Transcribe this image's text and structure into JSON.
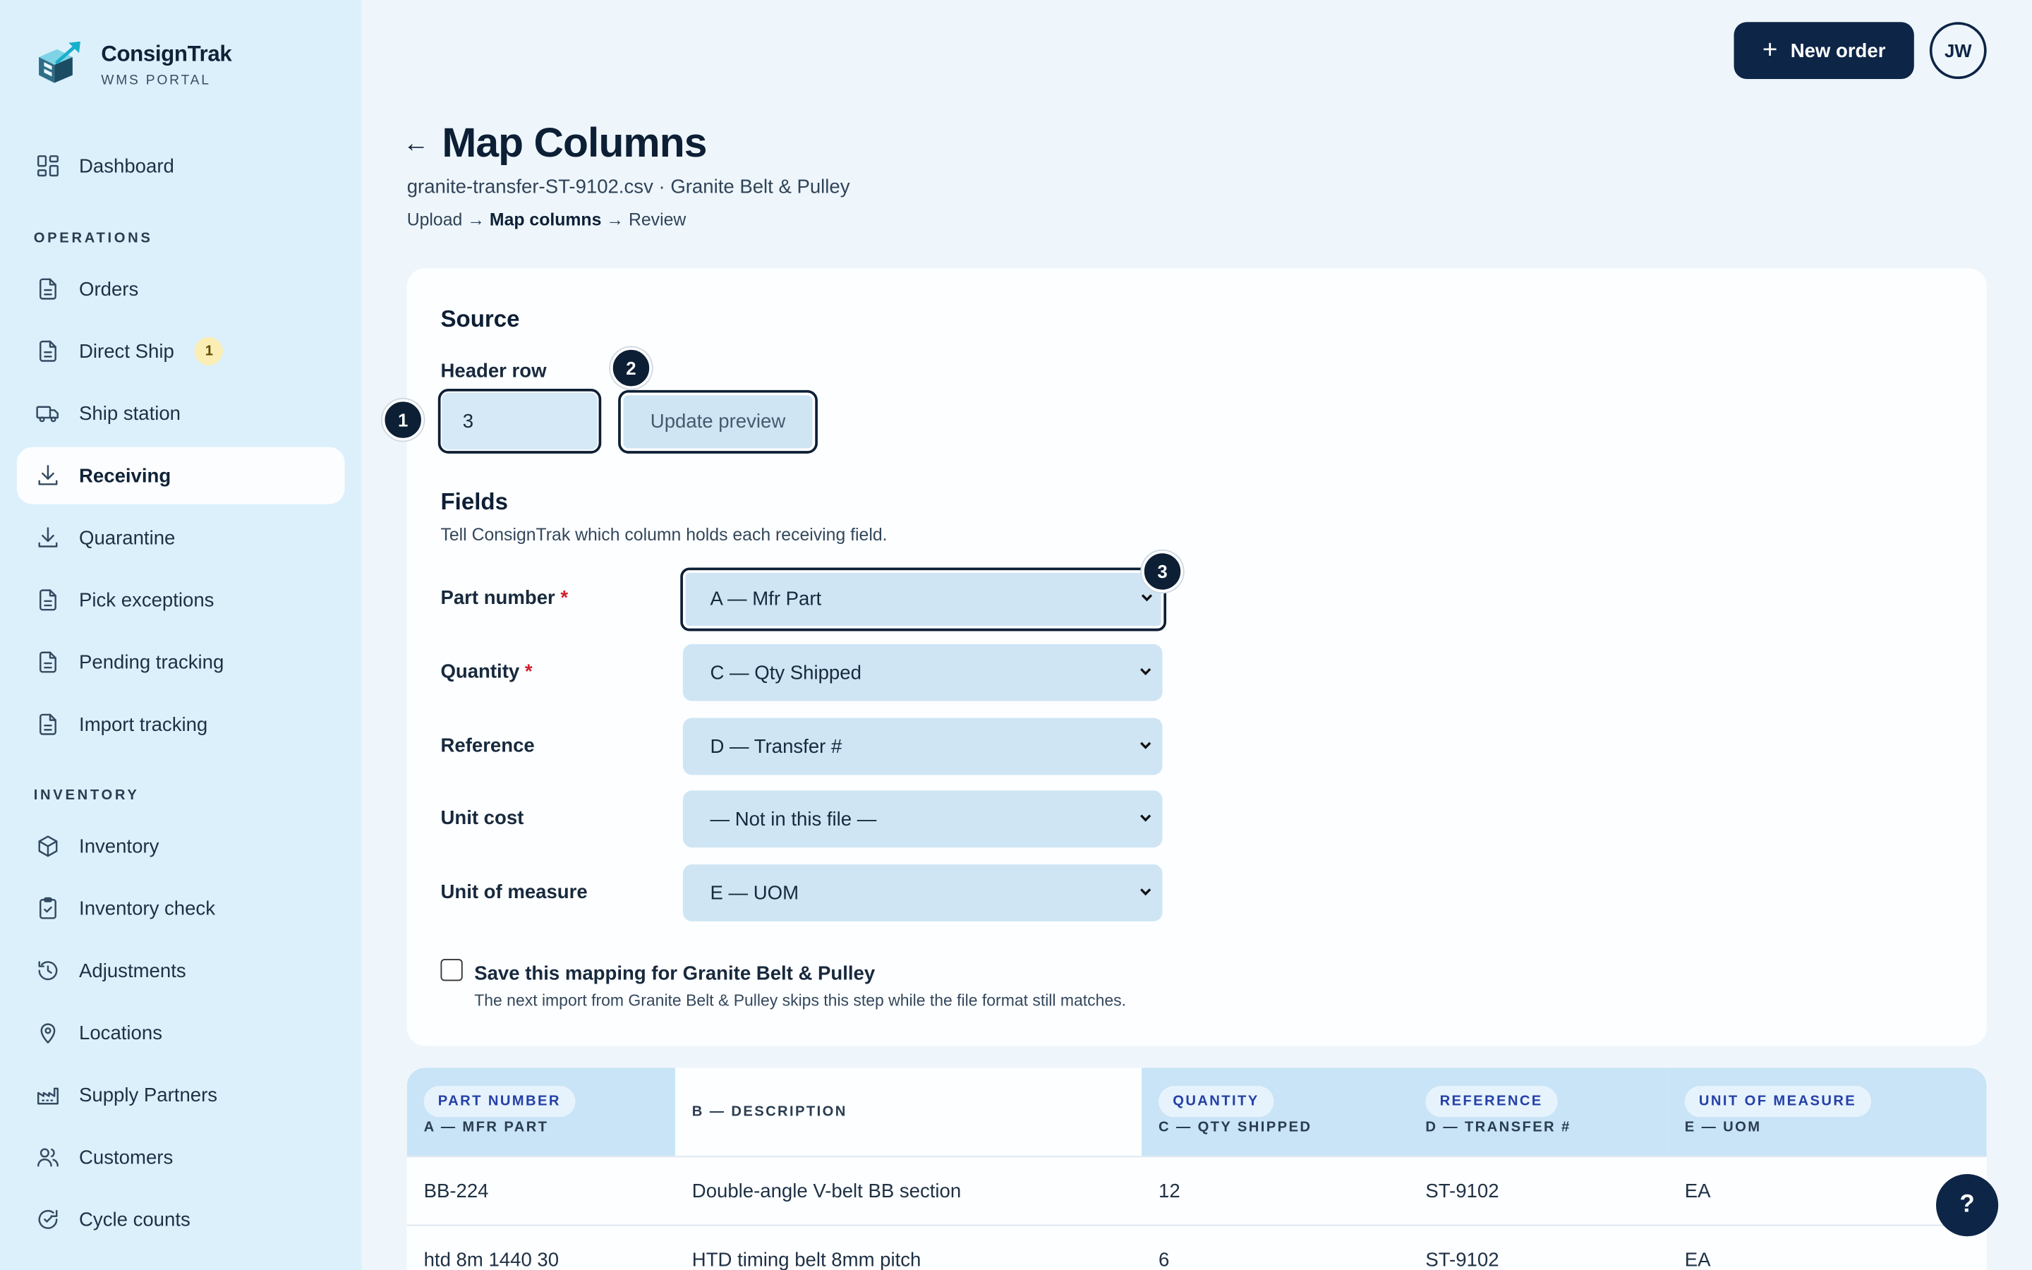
{
  "brand": {
    "name": "ConsignTrak",
    "subtitle": "WMS PORTAL"
  },
  "sidebar": {
    "top": [
      {
        "label": "Dashboard",
        "icon": "dashboard-icon"
      }
    ],
    "operations_label": "OPERATIONS",
    "operations": [
      {
        "label": "Orders",
        "icon": "document-icon"
      },
      {
        "label": "Direct Ship",
        "icon": "document-icon",
        "badge": "1"
      },
      {
        "label": "Ship station",
        "icon": "truck-icon"
      },
      {
        "label": "Receiving",
        "icon": "download-icon",
        "active": true
      },
      {
        "label": "Quarantine",
        "icon": "download-icon"
      },
      {
        "label": "Pick exceptions",
        "icon": "document-icon"
      },
      {
        "label": "Pending tracking",
        "icon": "document-icon"
      },
      {
        "label": "Import tracking",
        "icon": "document-icon"
      }
    ],
    "inventory_label": "INVENTORY",
    "inventory": [
      {
        "label": "Inventory",
        "icon": "box-icon"
      },
      {
        "label": "Inventory check",
        "icon": "clipboard-check-icon"
      },
      {
        "label": "Adjustments",
        "icon": "history-icon"
      },
      {
        "label": "Locations",
        "icon": "map-pin-icon"
      },
      {
        "label": "Supply Partners",
        "icon": "factory-icon"
      },
      {
        "label": "Customers",
        "icon": "users-icon"
      },
      {
        "label": "Cycle counts",
        "icon": "refresh-check-icon"
      }
    ]
  },
  "topbar": {
    "new_order_label": "New order",
    "new_order_plus": "+",
    "avatar_initials": "JW"
  },
  "header": {
    "back_arrow": "←",
    "title": "Map Columns",
    "file_line": "granite-transfer-ST-9102.csv · Granite Belt & Pulley",
    "crumb_1": "Upload →",
    "crumb_2": "Map columns",
    "crumb_3": "→ Review"
  },
  "source": {
    "heading": "Source",
    "header_row_label": "Header row",
    "header_row_value": "3",
    "update_button": "Update preview"
  },
  "markers": [
    "1",
    "2",
    "3"
  ],
  "fields": {
    "heading": "Fields",
    "description": "Tell ConsignTrak which column holds each receiving field.",
    "required_mark": "*",
    "rows": [
      {
        "label": "Part number",
        "required": true,
        "value": "A — Mfr Part"
      },
      {
        "label": "Quantity",
        "required": true,
        "value": "C — Qty Shipped"
      },
      {
        "label": "Reference",
        "required": false,
        "value": "D — Transfer #"
      },
      {
        "label": "Unit cost",
        "required": false,
        "value": "— Not in this file —"
      },
      {
        "label": "Unit of measure",
        "required": false,
        "value": "E — UOM"
      }
    ]
  },
  "save_mapping": {
    "checked": false,
    "label": "Save this mapping for Granite Belt & Pulley",
    "help": "The next import from Granite Belt & Pulley skips this step while the file format still matches."
  },
  "preview_table": {
    "columns": [
      {
        "field": "PART NUMBER",
        "source": "A — MFR PART",
        "mapped": true
      },
      {
        "field": "",
        "source": "B — DESCRIPTION",
        "mapped": false
      },
      {
        "field": "QUANTITY",
        "source": "C — QTY SHIPPED",
        "mapped": true
      },
      {
        "field": "REFERENCE",
        "source": "D — TRANSFER #",
        "mapped": true
      },
      {
        "field": "UNIT OF MEASURE",
        "source": "E — UOM",
        "mapped": true
      }
    ],
    "rows": [
      [
        "BB-224",
        "Double-angle V-belt BB section",
        "12",
        "ST-9102",
        "EA"
      ],
      [
        "htd 8m 1440 30",
        "HTD timing belt 8mm pitch",
        "6",
        "ST-9102",
        "EA"
      ]
    ]
  },
  "help_button": "?",
  "colors": {
    "primary": "#0d2546",
    "sidebar_bg": "#dcf0fc",
    "page_bg": "#eef6fc",
    "input_bg": "#cfe5f4",
    "required": "#d21f2b",
    "badge_bg": "#fbeeb5"
  }
}
